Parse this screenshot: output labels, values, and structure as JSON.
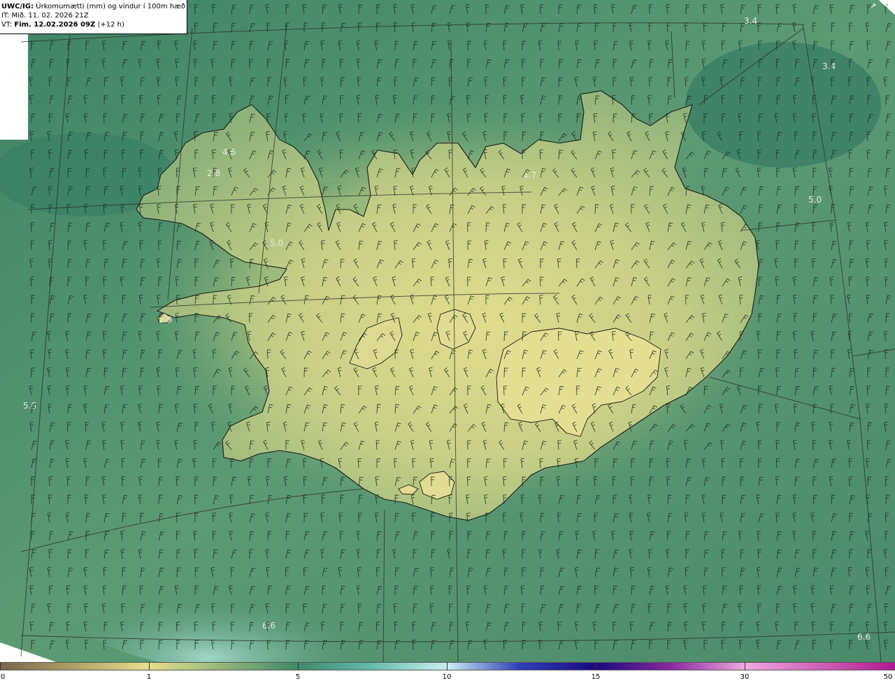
{
  "header": {
    "model": "UWC/IG:",
    "product": "Úrkomumætti (mm) og vindur í 100m hæð",
    "init_line": "IT: Mið. 11. 02. 2026 21Z",
    "valid_prefix": "VT: ",
    "valid_bold": "Fim. 12.02.2026 09Z",
    "valid_suffix": " (+12 h)"
  },
  "map_labels": [
    {
      "text": "3.4"
    },
    {
      "text": "3.4"
    },
    {
      "text": "4.6"
    },
    {
      "text": "2.8"
    },
    {
      "text": "4.7"
    },
    {
      "text": "5.0"
    },
    {
      "text": "5.0"
    },
    {
      "text": "2.9"
    },
    {
      "text": "5.6"
    },
    {
      "text": "6.6"
    },
    {
      "text": "6.6"
    }
  ],
  "colorbar": {
    "ticks": [
      "0",
      "1",
      "5",
      "10",
      "15",
      "30",
      "50"
    ],
    "colors": {
      "brown": "#7a6548",
      "yellow": "#e6e08a",
      "green": "#3e8a6a",
      "teal": "#5fb8a8",
      "cyan": "#c8f0f0",
      "blue": "#3040b8",
      "navy": "#1a0a80",
      "purple": "#8a2aa0",
      "pink": "#f0a8e0",
      "magenta": "#b01890"
    }
  },
  "colors": {
    "land_light": "#d9d98e",
    "land_mid": "#a8c07e",
    "sea_dark": "#3d8066",
    "sea_mid": "#5a9a72",
    "sea_light": "#8fcfc0",
    "coast": "#1a1a1a"
  }
}
